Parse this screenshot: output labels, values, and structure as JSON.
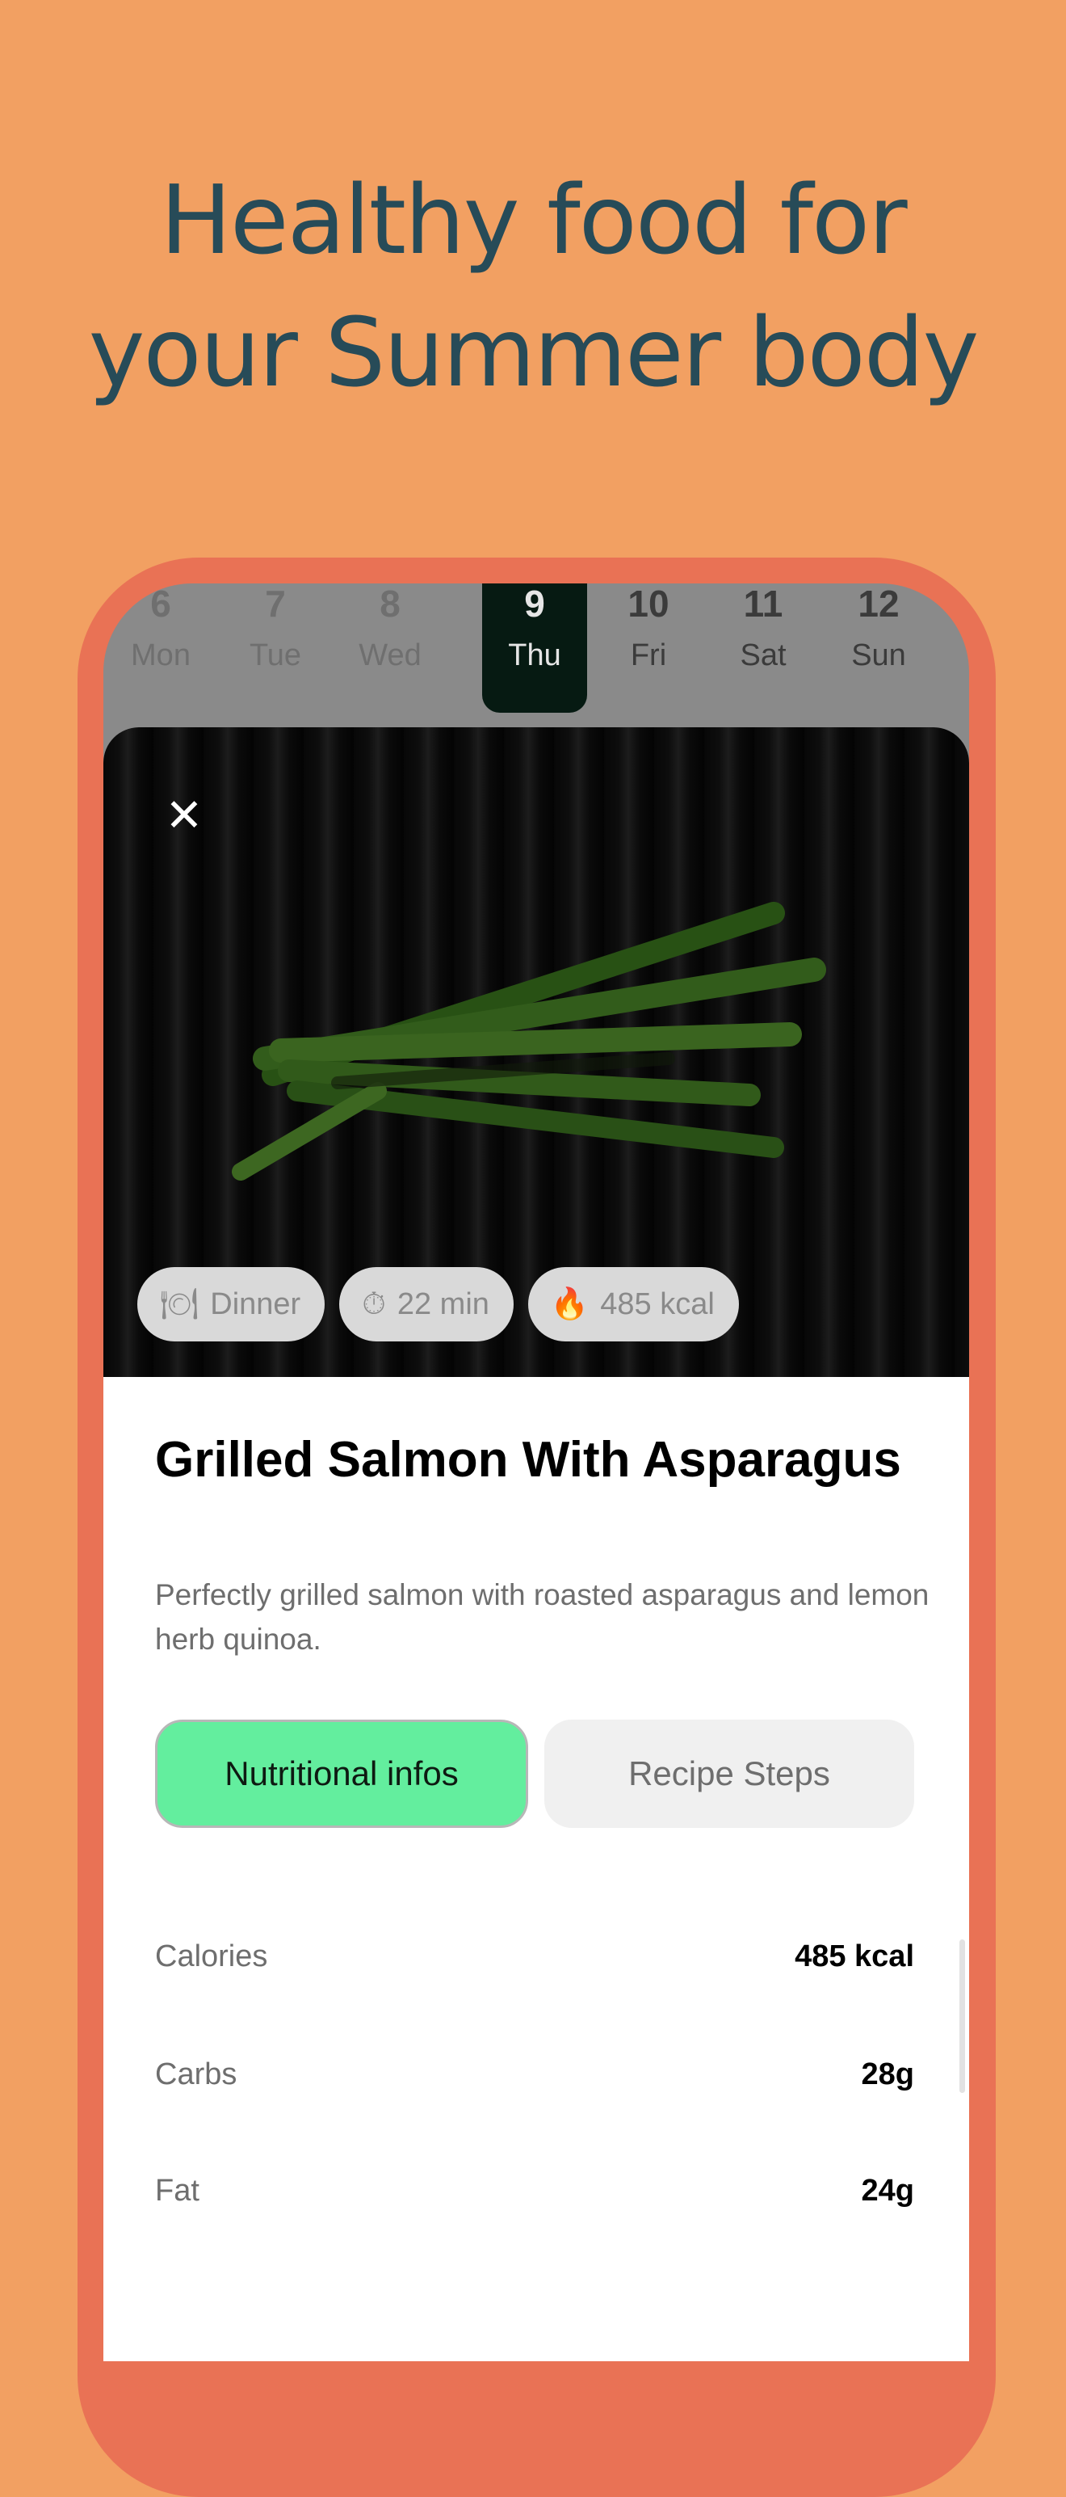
{
  "headline": [
    "Healthy food for",
    "your Summer body"
  ],
  "calendar": {
    "days": [
      {
        "num": "6",
        "dow": "Mon",
        "state": "past"
      },
      {
        "num": "7",
        "dow": "Tue",
        "state": "past"
      },
      {
        "num": "8",
        "dow": "Wed",
        "state": "past"
      },
      {
        "num": "9",
        "dow": "Thu",
        "state": "active"
      },
      {
        "num": "10",
        "dow": "Fri",
        "state": "upcoming"
      },
      {
        "num": "11",
        "dow": "Sat",
        "state": "upcoming"
      },
      {
        "num": "12",
        "dow": "Sun",
        "state": "upcoming"
      }
    ]
  },
  "recipe": {
    "close_icon": "close-icon",
    "chips": [
      {
        "icon": "plate-icon",
        "glyph": "🍽",
        "label": "Dinner"
      },
      {
        "icon": "stopwatch-icon",
        "glyph": "⏱",
        "label": "22 min"
      },
      {
        "icon": "fire-icon",
        "glyph": "🔥",
        "label": "485 kcal"
      }
    ],
    "title": "Grilled Salmon With Asparagus",
    "description": "Perfectly grilled salmon with roasted asparagus and lemon herb quinoa.",
    "tabs": {
      "active": "Nutritional infos",
      "inactive": "Recipe Steps"
    },
    "nutrition": [
      {
        "label": "Calories",
        "value": "485 kcal"
      },
      {
        "label": "Carbs",
        "value": "28g"
      },
      {
        "label": "Fat",
        "value": "24g"
      }
    ]
  },
  "colors": {
    "background": "#F2A062",
    "phone_frame": "#E97255",
    "headline": "#274B58",
    "active_tab": "#63EE9E"
  }
}
